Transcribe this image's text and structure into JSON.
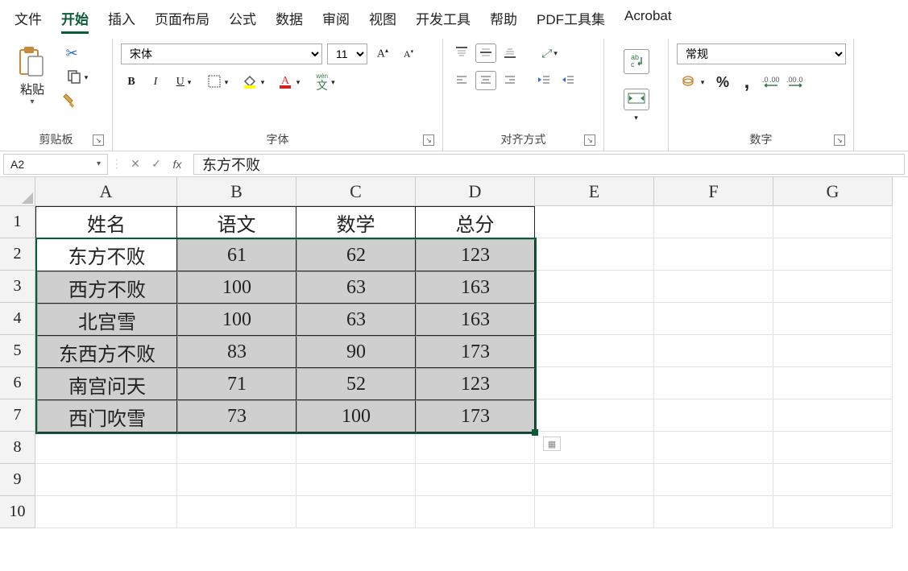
{
  "tabs": [
    "文件",
    "开始",
    "插入",
    "页面布局",
    "公式",
    "数据",
    "审阅",
    "视图",
    "开发工具",
    "帮助",
    "PDF工具集",
    "Acrobat"
  ],
  "active_tab_index": 1,
  "clipboard": {
    "paste_label": "粘贴",
    "group_label": "剪贴板"
  },
  "font": {
    "name": "宋体",
    "size": "11",
    "group_label": "字体",
    "wen_label": "wén",
    "wen_char": "文"
  },
  "alignment": {
    "group_label": "对齐方式"
  },
  "number": {
    "format": "常规",
    "group_label": "数字"
  },
  "name_box": "A2",
  "formula_value": "东方不败",
  "columns": [
    "A",
    "B",
    "C",
    "D",
    "E",
    "F",
    "G"
  ],
  "rows": [
    "1",
    "2",
    "3",
    "4",
    "5",
    "6",
    "7",
    "8",
    "9",
    "10"
  ],
  "data": {
    "headers": [
      "姓名",
      "语文",
      "数学",
      "总分"
    ],
    "rows": [
      [
        "东方不败",
        "61",
        "62",
        "123"
      ],
      [
        "西方不败",
        "100",
        "63",
        "163"
      ],
      [
        "北宫雪",
        "100",
        "63",
        "163"
      ],
      [
        "东西方不败",
        "83",
        "90",
        "173"
      ],
      [
        "南宫问天",
        "71",
        "52",
        "123"
      ],
      [
        "西门吹雪",
        "73",
        "100",
        "173"
      ]
    ]
  },
  "chart_data": {
    "type": "table",
    "columns": [
      "姓名",
      "语文",
      "数学",
      "总分"
    ],
    "rows": [
      {
        "姓名": "东方不败",
        "语文": 61,
        "数学": 62,
        "总分": 123
      },
      {
        "姓名": "西方不败",
        "语文": 100,
        "数学": 63,
        "总分": 163
      },
      {
        "姓名": "北宫雪",
        "语文": 100,
        "数学": 63,
        "总分": 163
      },
      {
        "姓名": "东西方不败",
        "语文": 83,
        "数学": 90,
        "总分": 173
      },
      {
        "姓名": "南宫问天",
        "语文": 71,
        "数学": 52,
        "总分": 123
      },
      {
        "姓名": "西门吹雪",
        "语文": 73,
        "数学": 100,
        "总分": 173
      }
    ]
  }
}
